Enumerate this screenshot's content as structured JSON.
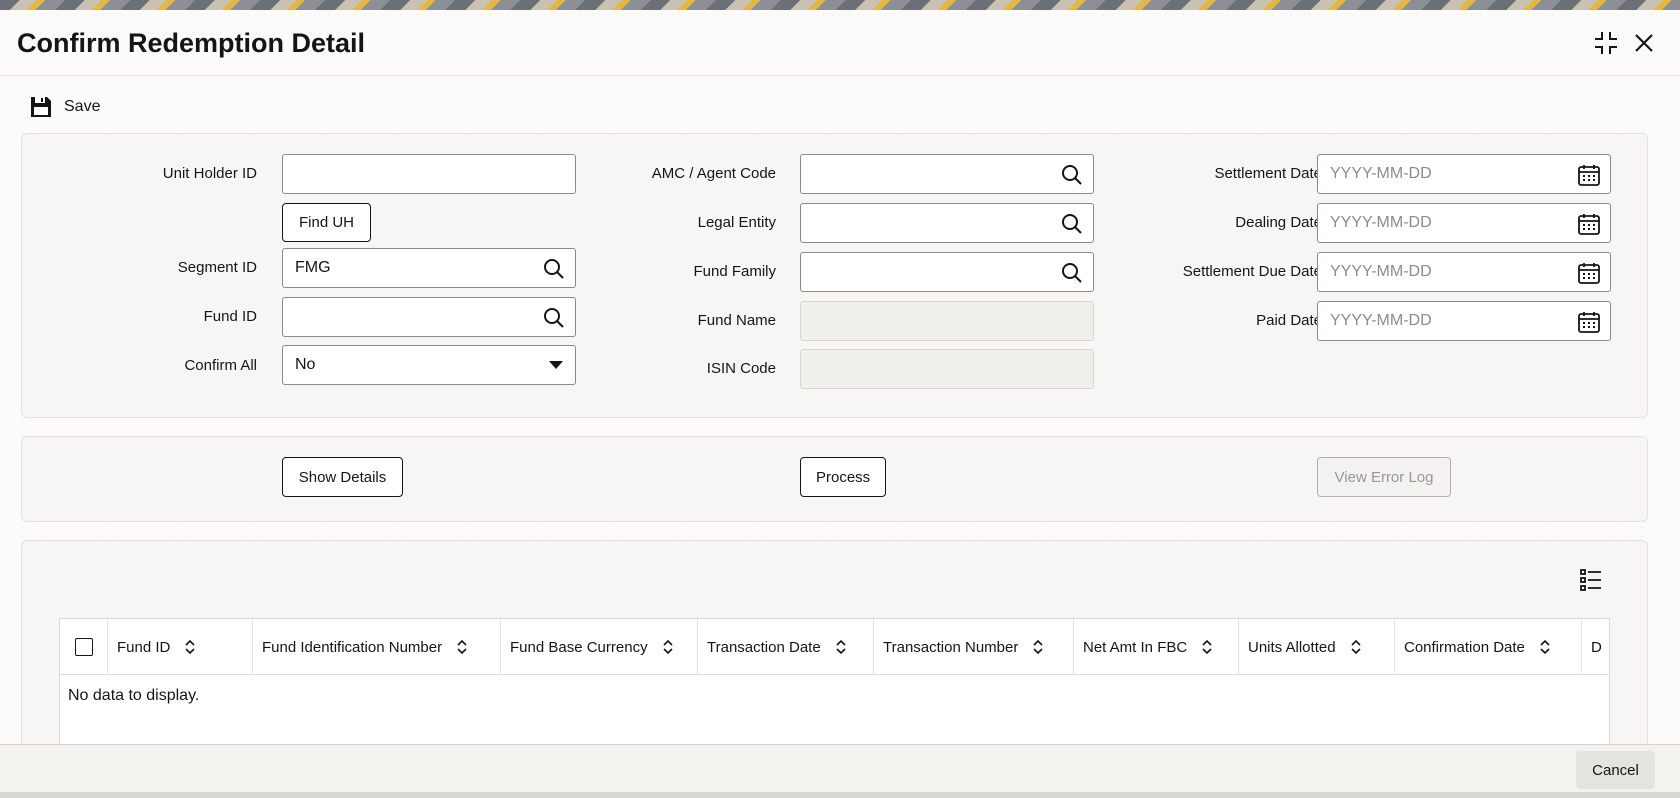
{
  "page": {
    "title": "Confirm Redemption Detail"
  },
  "toolbar": {
    "save_label": "Save"
  },
  "form": {
    "unit_holder_id": {
      "label": "Unit Holder ID",
      "value": ""
    },
    "find_uh_label": "Find UH",
    "segment_id": {
      "label": "Segment ID",
      "value": "FMG"
    },
    "fund_id": {
      "label": "Fund ID",
      "value": ""
    },
    "confirm_all": {
      "label": "Confirm All",
      "value": "No"
    },
    "amc_agent_code": {
      "label": "AMC / Agent Code",
      "value": ""
    },
    "legal_entity": {
      "label": "Legal Entity",
      "value": ""
    },
    "fund_family": {
      "label": "Fund Family",
      "value": ""
    },
    "fund_name": {
      "label": "Fund Name",
      "value": ""
    },
    "isin_code": {
      "label": "ISIN Code",
      "value": ""
    },
    "settlement_date": {
      "label": "Settlement Date",
      "placeholder": "YYYY-MM-DD"
    },
    "dealing_date": {
      "label": "Dealing Date",
      "placeholder": "YYYY-MM-DD"
    },
    "settlement_due_date": {
      "label": "Settlement Due Date",
      "placeholder": "YYYY-MM-DD"
    },
    "paid_date": {
      "label": "Paid Date",
      "placeholder": "YYYY-MM-DD"
    }
  },
  "actions": {
    "show_details_label": "Show Details",
    "process_label": "Process",
    "view_error_log_label": "View Error Log"
  },
  "grid": {
    "columns": [
      "Fund ID",
      "Fund Identification Number",
      "Fund Base Currency",
      "Transaction Date",
      "Transaction Number",
      "Net Amt In FBC",
      "Units Allotted",
      "Confirmation Date",
      "D"
    ],
    "empty_message": "No data to display."
  },
  "footer": {
    "cancel_label": "Cancel"
  },
  "icons": {
    "save": "floppy-disk-icon",
    "search": "search-icon",
    "calendar": "calendar-icon",
    "dropdown": "chevron-down-icon",
    "sort": "sort-icon",
    "column_picker": "list-icon",
    "maximize": "maximize-icon",
    "close": "close-icon"
  }
}
